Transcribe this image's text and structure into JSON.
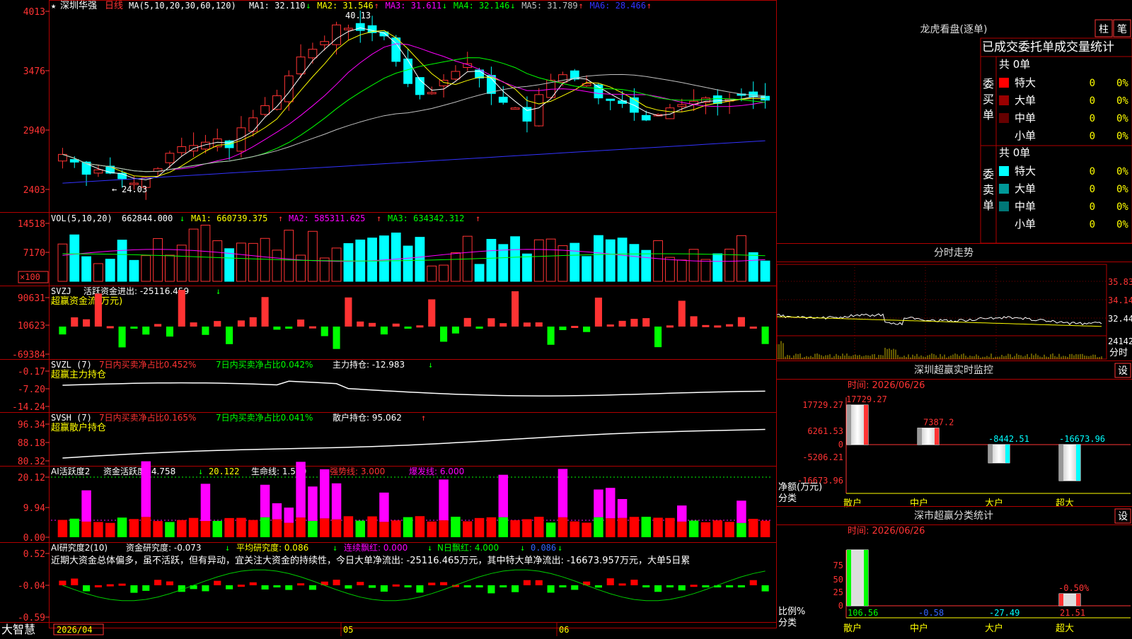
{
  "app": {
    "brand": "大智慧"
  },
  "main": {
    "price_panel": {
      "title_star": "★",
      "stock_name": "深圳华强",
      "period": "日线",
      "ma_params": "MA(5,10,20,30,60,120)",
      "ma_readouts": [
        {
          "label": "MA1:",
          "value": "32.110",
          "arrow": "↓",
          "color": "#ffffff"
        },
        {
          "label": "MA2:",
          "value": "31.546",
          "arrow": "↑",
          "color": "#ffff00"
        },
        {
          "label": "MA3:",
          "value": "31.611",
          "arrow": "↓",
          "color": "#ff00ff"
        },
        {
          "label": "MA4:",
          "value": "32.146",
          "arrow": "↓",
          "color": "#00ff00"
        },
        {
          "label": "MA5:",
          "value": "31.789",
          "arrow": "↑",
          "color": "#c0c0c0"
        },
        {
          "label": "MA6:",
          "value": "28.466",
          "arrow": "↑",
          "color": "#3333ff"
        }
      ],
      "y_ticks": [
        "4013",
        "3476",
        "2940",
        "2403"
      ],
      "high_label": "40.13",
      "low_label": "24.03"
    },
    "vol_panel": {
      "title": "VOL(5,10,20)",
      "value": "662844.000",
      "value_arrow": "↓",
      "ma1": "MA1: 660739.375",
      "ma1_arrow": "↑",
      "ma2": "MA2: 585311.625",
      "ma2_arrow": "↑",
      "ma3": "MA3: 634342.312",
      "ma3_arrow": "↑",
      "y_ticks": [
        "14518",
        "7170"
      ],
      "unit": "×100"
    },
    "svzj_panel": {
      "title": "SVZJ",
      "label": "活跃资金进出: -25116.459",
      "arrow": "↓",
      "subtitle": "超赢资金流(万元)",
      "y_ticks": [
        "90631",
        "10623",
        "-69384"
      ]
    },
    "svzl_panel": {
      "title": "SVZL (7)",
      "t1": "7日内买卖净占比0.452%",
      "t2": "7日内买卖净占比0.042%",
      "t3": "主力持仓: -12.983",
      "arrow": "↓",
      "subtitle": "超赢主力持仓",
      "y_ticks": [
        "-0.17",
        "-7.20",
        "-14.24"
      ]
    },
    "svsh_panel": {
      "title": "SVSH (7)",
      "t1": "7日内买卖净占比0.165%",
      "t2": "7日内买卖净占比0.041%",
      "t3": "散户持仓: 95.062",
      "arrow": "↑",
      "subtitle": "超赢散户持仓",
      "y_ticks": [
        "96.34",
        "88.18",
        "80.32"
      ]
    },
    "ai_active_panel": {
      "title": "AI活跃度2",
      "t1": "资金活跃度: 4.758",
      "t1_arrow": "↓",
      "t2": "20.122",
      "t3": "生命线: 1.560",
      "t4": "强势线: 3.000",
      "t5": "爆发线: 6.000",
      "y_ticks": [
        "20.12",
        "9.94",
        "0.00"
      ]
    },
    "ai_research_panel": {
      "title": "AI研究度2(10)",
      "t1": "资金研究度: -0.073",
      "t1_arrow": "↓",
      "t2": "平均研究度: 0.086",
      "t2_arrow": "↓",
      "t3": "连续飘红: 0.000",
      "t3_arrow": "↓",
      "t4": "N日飘红: 4.000",
      "t4_arrow": "↓",
      "t5": "0.086",
      "t5_arrow": "↓",
      "commentary": "近期大资金总体偏多，虽不活跃，但有异动，宜关注大资金的持续性，今日大单净流出: -25116.465万元，其中特大单净流出: -16673.957万元，大单5日累",
      "y_ticks": [
        "0.52",
        "-0.04",
        "-0.59"
      ]
    },
    "date_axis": [
      "2026/04",
      "05",
      "06"
    ]
  },
  "right": {
    "dragon_tiger": {
      "title": "龙虎看盘(逐单)",
      "btn_column": "柱",
      "btn_stroke": "笔",
      "table_title": "已成交委托单成交量统计",
      "buy_label": "委买单",
      "sell_label": "委卖单",
      "buy_total": "共 0单",
      "sell_total": "共 0单",
      "buy_rows": [
        {
          "label": "特大",
          "count": "0",
          "pct": "0%",
          "color": "#ff0000"
        },
        {
          "label": "大单",
          "count": "0",
          "pct": "0%",
          "color": "#990000"
        },
        {
          "label": "中单",
          "count": "0",
          "pct": "0%",
          "color": "#660000"
        },
        {
          "label": "小单",
          "count": "0",
          "pct": "0%",
          "color": "#000000"
        }
      ],
      "sell_rows": [
        {
          "label": "特大",
          "count": "0",
          "pct": "0%",
          "color": "#00ffff"
        },
        {
          "label": "大单",
          "count": "0",
          "pct": "0%",
          "color": "#009999"
        },
        {
          "label": "中单",
          "count": "0",
          "pct": "0%",
          "color": "#007777"
        },
        {
          "label": "小单",
          "count": "0",
          "pct": "0%",
          "color": "#000000"
        }
      ]
    },
    "intraday": {
      "title": "分时走势",
      "y_ticks": [
        "35.83",
        "34.14",
        "32.44"
      ],
      "vol_tick": "24142",
      "vol_label": "分时"
    },
    "sz_monitor": {
      "title": "深圳超赢实时监控",
      "settings_label": "设",
      "time_label": "时间: 2026/06/26",
      "y_ticks": [
        "17729.27",
        "6261.53",
        "0",
        "-5206.21",
        "-16673.96"
      ],
      "ylabel": "净额(万元)",
      "xlabel": "分类",
      "categories": [
        "散户",
        "中户",
        "大户",
        "超大"
      ],
      "values": [
        17729.27,
        7387.2,
        -8442.51,
        -16673.96
      ],
      "value_labels": [
        "17729.27",
        "7387.2",
        "-8442.51",
        "-16673.96"
      ]
    },
    "sz_class": {
      "title": "深市超赢分类统计",
      "settings_label": "设",
      "time_label": "时间: 2026/06/26",
      "y_ticks": [
        "75",
        "50",
        "25",
        "0"
      ],
      "ylabel": "比例%",
      "xlabel": "分类",
      "categories": [
        "散户",
        "中户",
        "大户",
        "超大"
      ],
      "values": [
        106.56,
        -0.58,
        -27.49,
        21.51
      ],
      "value_labels": [
        "106.56",
        "-0.58",
        "-27.49",
        "21.51"
      ],
      "extra_label": "-0.50%"
    }
  },
  "chart_data": [
    {
      "type": "candlestick",
      "title": "深圳华强 日线",
      "ylim": [
        24.03,
        40.13
      ],
      "y_ticks": [
        24.03,
        29.4,
        34.76,
        40.13
      ],
      "x_ticks": [
        "2026/04",
        "05",
        "06"
      ],
      "series": [
        {
          "name": "MA1"
        },
        {
          "name": "MA2"
        },
        {
          "name": "MA3"
        },
        {
          "name": "MA4"
        },
        {
          "name": "MA5"
        },
        {
          "name": "MA6"
        }
      ],
      "approx_close_path": [
        27.2,
        26.5,
        25.4,
        25.8,
        25.5,
        25.0,
        24.6,
        25.1,
        25.9,
        27.3,
        27.9,
        28.0,
        28.3,
        28.6,
        27.8,
        29.6,
        30.5,
        31.6,
        32.5,
        34.3,
        36.0,
        36.7,
        37.4,
        38.9,
        38.6,
        38.4,
        38.2,
        37.9,
        35.6,
        33.6,
        32.6,
        32.8,
        33.9,
        34.7,
        35.4,
        34.1,
        32.7,
        31.9,
        31.4,
        30.2,
        32.6,
        33.9,
        34.4,
        34.0,
        33.6,
        32.3,
        32.1,
        31.8,
        31.0,
        30.3,
        30.8,
        31.4,
        31.7,
        32.0,
        32.3,
        31.8,
        32.2,
        32.6,
        32.4,
        32.1
      ]
    },
    {
      "type": "bar",
      "title": "VOL(5,10,20)",
      "ylim": [
        0,
        14518
      ],
      "y_ticks": [
        7170,
        14518
      ],
      "series": [
        {
          "name": "MA1"
        },
        {
          "name": "MA2"
        },
        {
          "name": "MA3"
        }
      ]
    },
    {
      "type": "bar",
      "title": "深圳超赢实时监控",
      "categories": [
        "散户",
        "中户",
        "大户",
        "超大"
      ],
      "values": [
        17729.27,
        7387.2,
        -8442.51,
        -16673.96
      ],
      "ylabel": "净额(万元)",
      "xlabel": "分类",
      "ylim": [
        -16673.96,
        17729.27
      ]
    },
    {
      "type": "bar",
      "title": "深市超赢分类统计",
      "categories": [
        "散户",
        "中户",
        "大户",
        "超大"
      ],
      "values": [
        106.56,
        -0.58,
        -27.49,
        21.51
      ],
      "ylabel": "比例%",
      "xlabel": "分类",
      "ylim": [
        0,
        75
      ]
    }
  ]
}
